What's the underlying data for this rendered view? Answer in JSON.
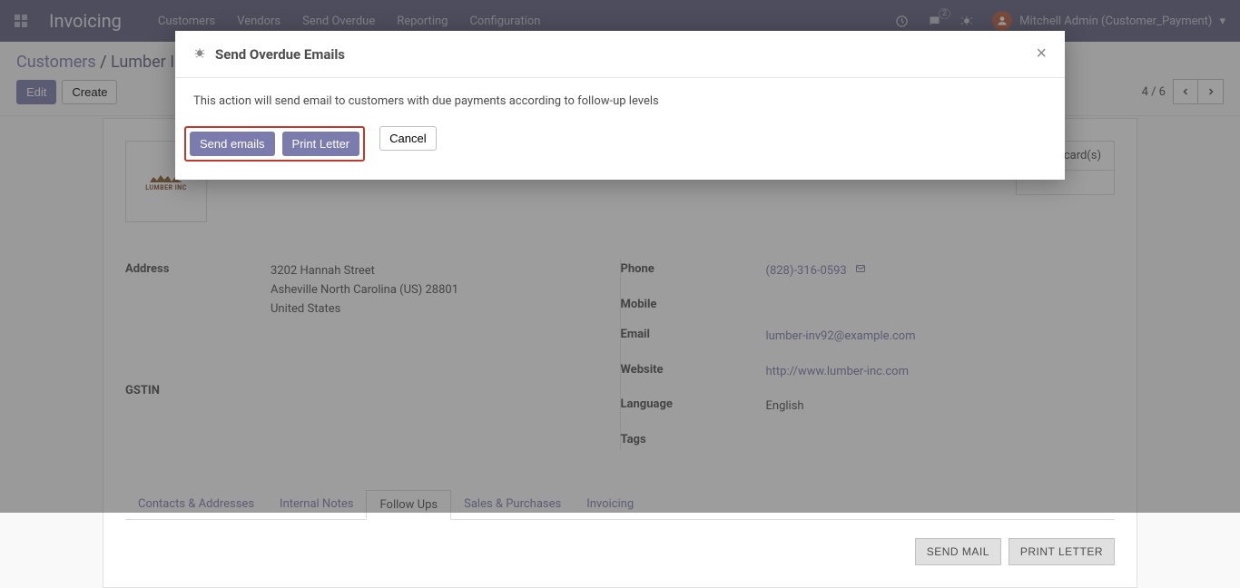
{
  "topbar": {
    "brand": "Invoicing",
    "menu": [
      "Customers",
      "Vendors",
      "Send Overdue",
      "Reporting",
      "Configuration"
    ],
    "chat_badge": "2",
    "user": "Mitchell Admin (Customer_Payment)"
  },
  "breadcrumb": {
    "parent": "Customers",
    "current": "Lumber Inc"
  },
  "buttons": {
    "edit": "Edit",
    "create": "Create"
  },
  "pager": {
    "position": "4 / 6"
  },
  "card": {
    "logo_name": "LUMBER INC",
    "stat_box": {
      "line1": "Credit card(s)",
      "line2": ""
    }
  },
  "fields": {
    "address_label": "Address",
    "address": {
      "street": "3202 Hannah Street",
      "city_line": "Asheville  North Carolina (US)  28801",
      "country": "United States"
    },
    "gstin_label": "GSTIN",
    "phone_label": "Phone",
    "phone": "(828)-316-0593",
    "mobile_label": "Mobile",
    "email_label": "Email",
    "email": "lumber-inv92@example.com",
    "website_label": "Website",
    "website": "http://www.lumber-inc.com",
    "language_label": "Language",
    "language": "English",
    "tags_label": "Tags"
  },
  "tabs": [
    "Contacts & Addresses",
    "Internal Notes",
    "Follow Ups",
    "Sales & Purchases",
    "Invoicing"
  ],
  "tab_active_index": 2,
  "tab_actions": {
    "send_mail": "SEND MAIL",
    "print_letter": "PRINT LETTER"
  },
  "modal": {
    "title": "Send Overdue Emails",
    "body": "This action will send email to customers with due payments according to follow-up levels",
    "send_emails": "Send emails",
    "print_letter": "Print Letter",
    "cancel": "Cancel"
  }
}
